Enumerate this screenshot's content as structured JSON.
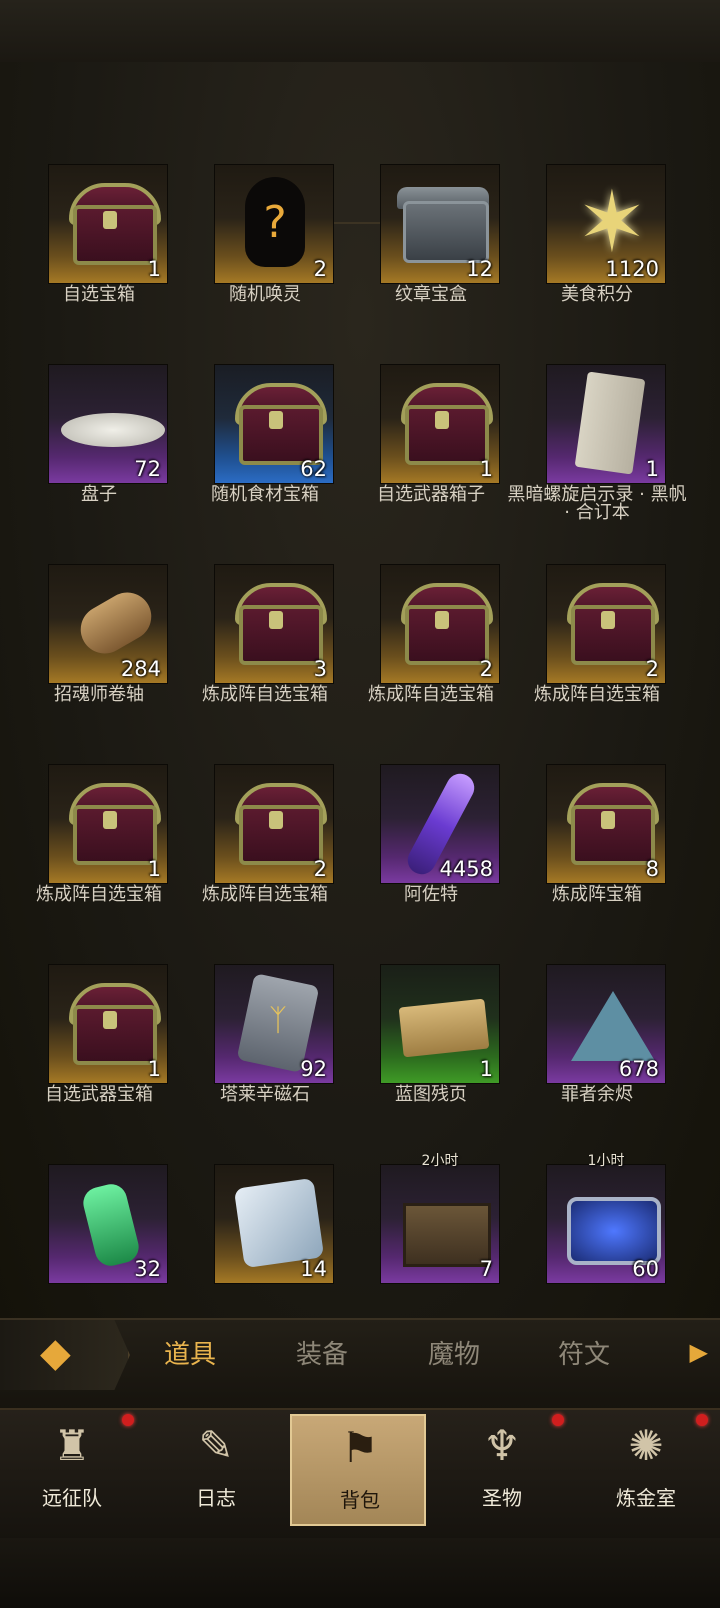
{
  "items": [
    {
      "name": "自选宝箱",
      "count": "1",
      "rarity": "gold",
      "icon": "chest-icon"
    },
    {
      "name": "随机唤灵",
      "count": "2",
      "rarity": "gold",
      "icon": "mystery-silhouette-icon"
    },
    {
      "name": "纹章宝盒",
      "count": "12",
      "rarity": "gold",
      "icon": "ornate-box-icon"
    },
    {
      "name": "美食积分",
      "count": "1120",
      "rarity": "gold",
      "icon": "star-crystal-icon"
    },
    {
      "name": "盘子",
      "count": "72",
      "rarity": "purple",
      "icon": "plate-icon"
    },
    {
      "name": "随机食材宝箱",
      "count": "62",
      "rarity": "blue",
      "icon": "chest-icon"
    },
    {
      "name": "自选武器箱子",
      "count": "1",
      "rarity": "gold",
      "icon": "chest-icon"
    },
    {
      "name": "黑暗螺旋启示录 · 黑帆 · 合订本",
      "count": "1",
      "rarity": "purple",
      "icon": "scroll-icon"
    },
    {
      "name": "招魂师卷轴",
      "count": "284",
      "rarity": "gold",
      "icon": "rolled-scroll-icon"
    },
    {
      "name": "炼成阵自选宝箱",
      "count": "3",
      "rarity": "gold",
      "icon": "chest-icon"
    },
    {
      "name": "炼成阵自选宝箱",
      "count": "2",
      "rarity": "gold",
      "icon": "chest-icon"
    },
    {
      "name": "炼成阵自选宝箱",
      "count": "2",
      "rarity": "gold",
      "icon": "chest-icon"
    },
    {
      "name": "炼成阵自选宝箱",
      "count": "1",
      "rarity": "gold",
      "icon": "chest-icon"
    },
    {
      "name": "炼成阵自选宝箱",
      "count": "2",
      "rarity": "gold",
      "icon": "chest-icon"
    },
    {
      "name": "阿佐特",
      "count": "4458",
      "rarity": "purple",
      "icon": "crystal-vial-icon"
    },
    {
      "name": "炼成阵宝箱",
      "count": "8",
      "rarity": "gold",
      "icon": "chest-icon"
    },
    {
      "name": "自选武器宝箱",
      "count": "1",
      "rarity": "gold",
      "icon": "chest-icon"
    },
    {
      "name": "塔莱辛磁石",
      "count": "92",
      "rarity": "purple",
      "icon": "rune-stone-icon"
    },
    {
      "name": "蓝图残页",
      "count": "1",
      "rarity": "green",
      "icon": "blueprint-paper-icon"
    },
    {
      "name": "罪者余烬",
      "count": "678",
      "rarity": "purple",
      "icon": "ember-pyramid-icon"
    },
    {
      "name": "",
      "count": "32",
      "rarity": "purple",
      "icon": "green-potion-icon"
    },
    {
      "name": "",
      "count": "14",
      "rarity": "gold",
      "icon": "ice-shard-icon"
    },
    {
      "name": "",
      "count": "7",
      "rarity": "purple",
      "icon": "crate-icon",
      "timer": "2小时"
    },
    {
      "name": "",
      "count": "60",
      "rarity": "purple",
      "icon": "blue-chest-icon",
      "timer": "1小时"
    }
  ],
  "tabs": [
    {
      "label": "道具",
      "active": true
    },
    {
      "label": "装备",
      "active": false
    },
    {
      "label": "魔物",
      "active": false
    },
    {
      "label": "符文",
      "active": false
    }
  ],
  "nav": [
    {
      "label": "远征队",
      "icon": "horned-helmet-icon",
      "badge": true,
      "active": false
    },
    {
      "label": "日志",
      "icon": "journal-icon",
      "badge": false,
      "active": false
    },
    {
      "label": "背包",
      "icon": "backpack-icon",
      "badge": false,
      "active": true
    },
    {
      "label": "圣物",
      "icon": "torch-icon",
      "badge": true,
      "active": false
    },
    {
      "label": "炼金室",
      "icon": "alchemy-icon",
      "badge": true,
      "active": false
    }
  ],
  "colors": {
    "accent": "#e9b44e",
    "badge": "#d11e1e",
    "rarity_gold": "#a57925",
    "rarity_purple": "#7a3aa0",
    "rarity_blue": "#2b6cc4",
    "rarity_green": "#3f9b26"
  }
}
